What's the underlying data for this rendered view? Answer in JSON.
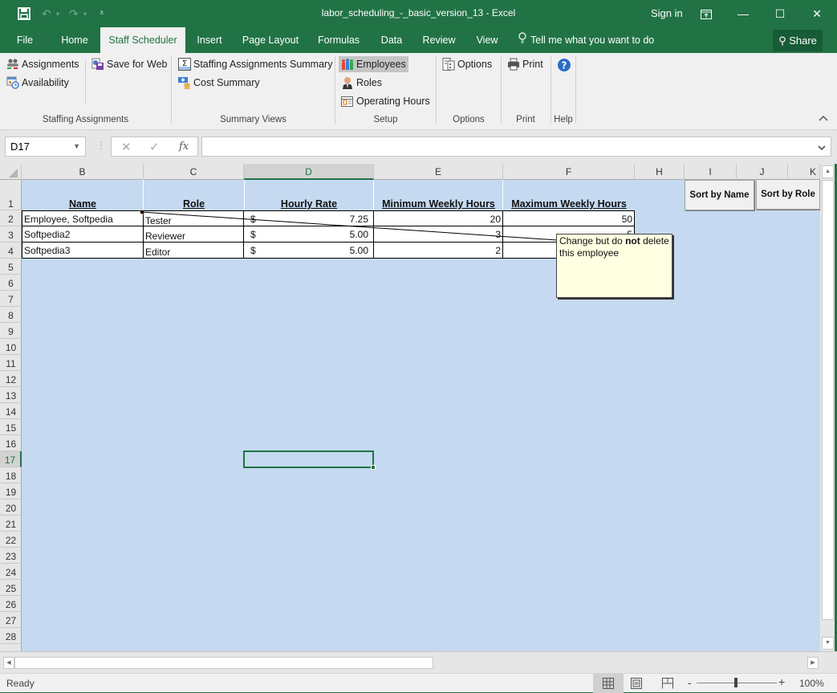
{
  "window": {
    "title": "labor_scheduling_-_basic_version_13 - Excel",
    "sign_in": "Sign in"
  },
  "tabs": [
    {
      "label": "File"
    },
    {
      "label": "Home"
    },
    {
      "label": "Staff Scheduler",
      "active": true
    },
    {
      "label": "Insert"
    },
    {
      "label": "Page Layout"
    },
    {
      "label": "Formulas"
    },
    {
      "label": "Data"
    },
    {
      "label": "Review"
    },
    {
      "label": "View"
    }
  ],
  "tell_me": "Tell me what you want to do",
  "share_label": "Share",
  "ribbon": {
    "groups": {
      "staffing": {
        "label": "Staffing Assignments",
        "assignments": "Assignments",
        "availability": "Availability",
        "save_for_web": "Save for Web"
      },
      "summary": {
        "label": "Summary Views",
        "staffing_summary": "Staffing Assignments Summary",
        "cost_summary": "Cost Summary"
      },
      "setup": {
        "label": "Setup",
        "employees": "Employees",
        "roles": "Roles",
        "operating_hours": "Operating Hours"
      },
      "options": {
        "label": "Options",
        "options": "Options"
      },
      "print": {
        "label": "Print",
        "print": "Print"
      },
      "help": {
        "label": "Help"
      }
    }
  },
  "formula_bar": {
    "name_box": "D17",
    "fx": "fx",
    "formula": ""
  },
  "sheet": {
    "columns": [
      "B",
      "C",
      "D",
      "E",
      "F",
      "H",
      "I",
      "J",
      "K"
    ],
    "selected_column": "D",
    "rows": [
      "1",
      "2",
      "3",
      "4",
      "5",
      "6",
      "7",
      "8",
      "9",
      "10",
      "11",
      "12",
      "13",
      "14",
      "15",
      "16",
      "17",
      "18",
      "19",
      "20",
      "21",
      "22",
      "23",
      "24",
      "25",
      "26",
      "27",
      "28"
    ],
    "selected_row": "17",
    "headers": {
      "name": "Name",
      "role": "Role",
      "hourly_rate": "Hourly Rate",
      "min_hours": "Minimum Weekly Hours",
      "max_hours": "Maximum Weekly Hours"
    },
    "employees": [
      {
        "name": "Employee, Softpedia",
        "role": "Tester",
        "currency": "$",
        "rate": "7.25",
        "min": "20",
        "max": "50"
      },
      {
        "name": "Softpedia2",
        "role": "Reviewer",
        "currency": "$",
        "rate": "5.00",
        "min": "3",
        "max": "5"
      },
      {
        "name": "Softpedia3",
        "role": "Editor",
        "currency": "$",
        "rate": "5.00",
        "min": "2",
        "max": ""
      }
    ],
    "sort_by_name": "Sort by Name",
    "sort_by_role": "Sort by Role",
    "comment": {
      "prefix": "Change but do ",
      "bold": "not",
      "suffix": " delete this employee"
    }
  },
  "status": {
    "text": "Ready",
    "zoom": "100%",
    "zoom_minus": "-",
    "zoom_plus": "+"
  },
  "colors": {
    "accent": "#217346",
    "sheet_bg": "#c5d9f1",
    "comment_bg": "#ffffe1"
  }
}
